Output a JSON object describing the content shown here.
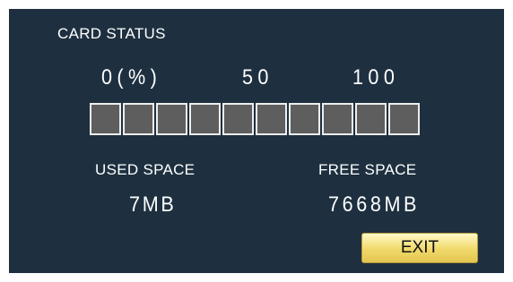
{
  "card_status": {
    "title": "CARD STATUS",
    "scale": {
      "start": "0(%)",
      "middle": "50",
      "end": "100"
    },
    "usage_bar": {
      "segments": 10,
      "filled_segments": 0,
      "used_fraction": 0.001
    },
    "used_space": {
      "label": "USED SPACE",
      "value": "7MB"
    },
    "free_space": {
      "label": "FREE SPACE",
      "value": "7668MB"
    },
    "exit_label": "EXIT"
  },
  "colors": {
    "background": "#1e3040",
    "segment_empty": "#5e5e5e",
    "segment_border": "#eeeeee",
    "exit_button": "#f0d96a"
  }
}
